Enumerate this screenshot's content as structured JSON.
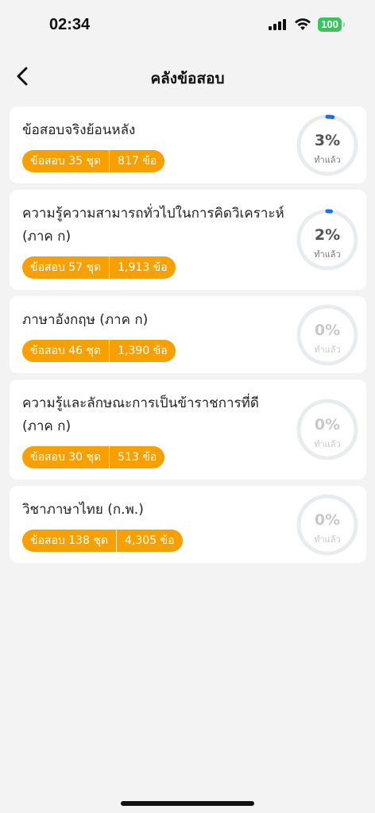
{
  "status_bar": {
    "time": "02:34",
    "battery": "100"
  },
  "header": {
    "title": "คลังข้อสอบ"
  },
  "colors": {
    "accent": "#f7a000",
    "progress": "#1e6fe3",
    "ring_track": "#e9ecef"
  },
  "exams": [
    {
      "title": "ข้อสอบจริงย้อนหลัง",
      "sets_label": "ข้อสอบ 35 ชุด",
      "questions_label": "817 ข้อ",
      "percent_label": "3%",
      "progress": 0.03,
      "done_label": "ทำแล้ว"
    },
    {
      "title": "ความรู้ความสามารถทั่วไปในการคิดวิเคราะห์ (ภาค ก)",
      "sets_label": "ข้อสอบ 57 ชุด",
      "questions_label": "1,913 ข้อ",
      "percent_label": "2%",
      "progress": 0.02,
      "done_label": "ทำแล้ว"
    },
    {
      "title": "ภาษาอังกฤษ (ภาค ก)",
      "sets_label": "ข้อสอบ 46 ชุด",
      "questions_label": "1,390 ข้อ",
      "percent_label": "0%",
      "progress": 0,
      "done_label": "ทำแล้ว"
    },
    {
      "title": "ความรู้และลักษณะการเป็นข้าราชการที่ดี (ภาค ก)",
      "sets_label": "ข้อสอบ 30 ชุด",
      "questions_label": "513 ข้อ",
      "percent_label": "0%",
      "progress": 0,
      "done_label": "ทำแล้ว"
    },
    {
      "title": "วิชาภาษาไทย (ก.พ.)",
      "sets_label": "ข้อสอบ 138 ชุด",
      "questions_label": "4,305 ข้อ",
      "percent_label": "0%",
      "progress": 0,
      "done_label": "ทำแล้ว"
    }
  ]
}
